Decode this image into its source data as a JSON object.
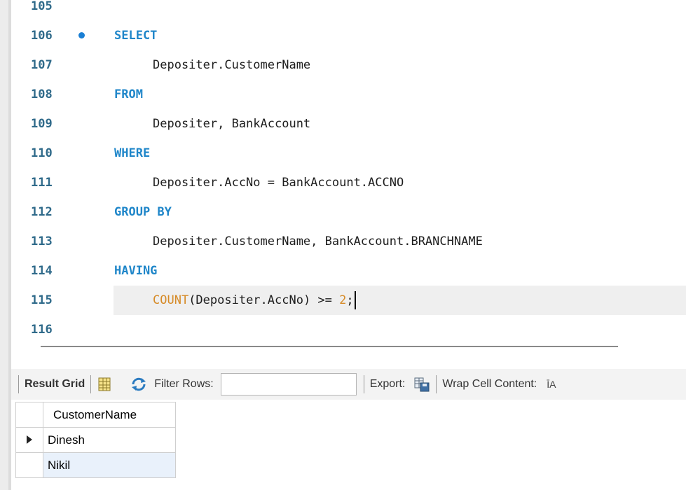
{
  "editor": {
    "lines": [
      {
        "no": "105",
        "indent": 0,
        "tokens": []
      },
      {
        "no": "106",
        "indent": 0,
        "tokens": [
          {
            "t": "SELECT",
            "c": "kw"
          }
        ],
        "marker": true
      },
      {
        "no": "107",
        "indent": 1,
        "tokens": [
          {
            "t": "Depositer.CustomerName",
            "c": ""
          }
        ]
      },
      {
        "no": "108",
        "indent": 0,
        "tokens": [
          {
            "t": "FROM",
            "c": "kw"
          }
        ]
      },
      {
        "no": "109",
        "indent": 1,
        "tokens": [
          {
            "t": "Depositer, BankAccount",
            "c": ""
          }
        ]
      },
      {
        "no": "110",
        "indent": 0,
        "tokens": [
          {
            "t": "WHERE",
            "c": "kw"
          }
        ]
      },
      {
        "no": "111",
        "indent": 1,
        "tokens": [
          {
            "t": "Depositer.AccNo = BankAccount.ACCNO",
            "c": ""
          }
        ]
      },
      {
        "no": "112",
        "indent": 0,
        "tokens": [
          {
            "t": "GROUP BY",
            "c": "kw"
          }
        ]
      },
      {
        "no": "113",
        "indent": 1,
        "tokens": [
          {
            "t": "Depositer.CustomerName, BankAccount.BRANCHNAME",
            "c": ""
          }
        ]
      },
      {
        "no": "114",
        "indent": 0,
        "tokens": [
          {
            "t": "HAVING",
            "c": "kw"
          }
        ]
      },
      {
        "no": "115",
        "indent": 1,
        "tokens": [
          {
            "t": "COUNT",
            "c": "fn"
          },
          {
            "t": "(Depositer.AccNo) >= ",
            "c": ""
          },
          {
            "t": "2",
            "c": "num"
          },
          {
            "t": ";",
            "c": ""
          }
        ],
        "current": true
      },
      {
        "no": "116",
        "indent": 0,
        "tokens": []
      }
    ]
  },
  "toolbar": {
    "result_grid_label": "Result Grid",
    "filter_rows_label": "Filter Rows:",
    "filter_value": "",
    "export_label": "Export:",
    "wrap_label": "Wrap Cell Content:",
    "wrap_icon_text": "ĪA"
  },
  "results": {
    "columns": [
      "CustomerName"
    ],
    "rows": [
      [
        "Dinesh"
      ],
      [
        "Nikil"
      ]
    ],
    "selected_row": 0
  }
}
